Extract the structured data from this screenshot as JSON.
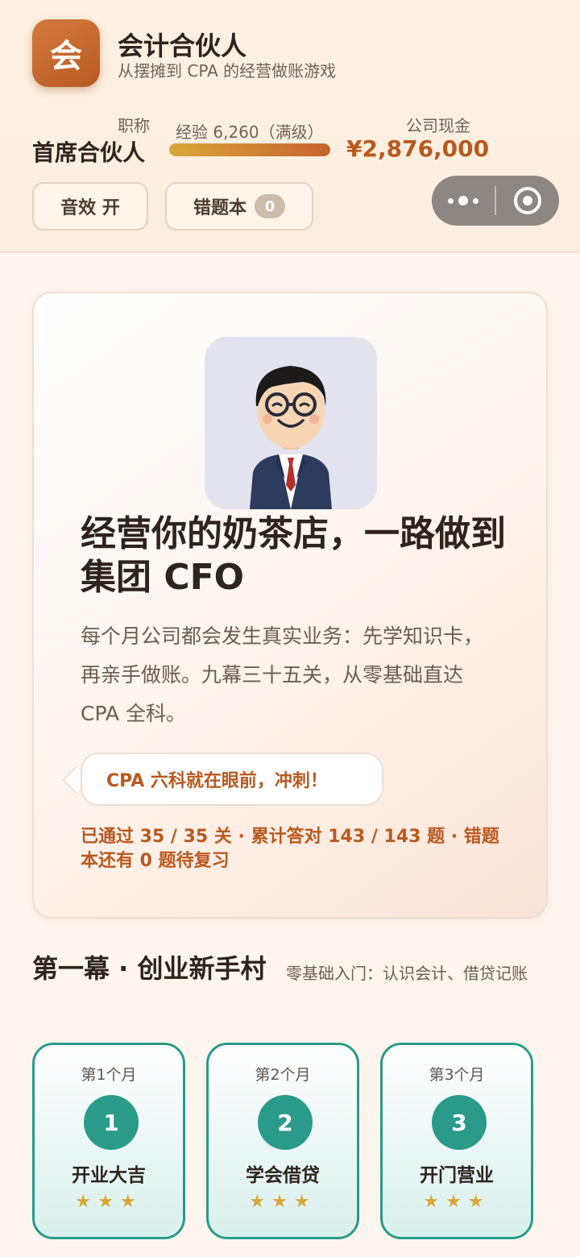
{
  "app": {
    "icon_char": "会",
    "title": "会计合伙人",
    "subtitle": "从摆摊到 CPA 的经营做账游戏"
  },
  "status": {
    "rank_label": "职称",
    "rank_value": "首席合伙人",
    "xp_label": "经验 6,260（满级）",
    "xp_progress": 1.0,
    "cash_label": "公司现金",
    "cash_value": "¥2,876,000"
  },
  "toolbar": {
    "sound_label": "音效 开",
    "mistake_label": "错题本",
    "mistake_count": "0"
  },
  "hero": {
    "title": "经营你的奶茶店，一路做到集团 CFO",
    "description": "每个月公司都会发生真实业务：先学知识卡，再亲手做账。九幕三十五关，从零基础直达 CPA 全科。",
    "bubble": "CPA 六科就在眼前，冲刺！",
    "stats": "已通过 35 / 35 关 · 累计答对 143 / 143 题 · 错题本还有 0 题待复习"
  },
  "chapter": {
    "title": "第一幕 · 创业新手村",
    "subtitle": "零基础入门：认识会计、借贷记账",
    "levels": [
      {
        "month": "第1个月",
        "number": "1",
        "name": "开业大吉",
        "stars": "★★★"
      },
      {
        "month": "第2个月",
        "number": "2",
        "name": "学会借贷",
        "stars": "★★★"
      },
      {
        "month": "第3个月",
        "number": "3",
        "name": "开门营业",
        "stars": "★★★"
      }
    ]
  },
  "colors": {
    "accent": "#b9591f",
    "teal": "#2a9a8a",
    "gold": "#d9a73a"
  }
}
